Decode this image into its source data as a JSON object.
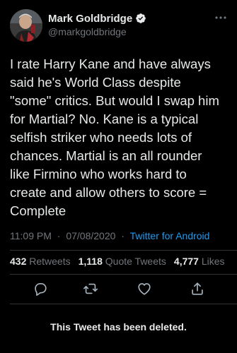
{
  "author": {
    "display_name": "Mark Goldbridge",
    "handle": "@markgoldbridge",
    "verified": true,
    "avatar_icon": "avatar-photo"
  },
  "tweet": {
    "lines": [
      "I rate Harry Kane and have always",
      "said he's World Class despite",
      "\"some\" critics. But would I swap him",
      "for Martial? No. Kane is a typical",
      "selfish striker who needs lots of",
      "chances. Martial is an all rounder",
      "like Firmino who works hard to",
      "create and allow others to score =",
      "Complete"
    ]
  },
  "meta": {
    "time": "11:09 PM",
    "date": "07/08/2020",
    "separator_time_date": "·",
    "separator_source": "·",
    "source": "Twitter for Android"
  },
  "stats": {
    "retweets_count": "432",
    "retweets_label": "Retweets",
    "quote_count": "1,118",
    "quote_label": "Quote Tweets",
    "likes_count": "4,777",
    "likes_label": "Likes"
  },
  "actions": [
    {
      "icon": "reply-icon"
    },
    {
      "icon": "retweet-icon"
    },
    {
      "icon": "like-icon"
    },
    {
      "icon": "share-icon"
    }
  ],
  "notice": {
    "text": "This Tweet has been deleted."
  },
  "colors": {
    "background": "#000000",
    "text": "#e7e9ea",
    "secondary": "#71767b",
    "accent": "#1d9bf0",
    "divider": "#2f3336"
  }
}
